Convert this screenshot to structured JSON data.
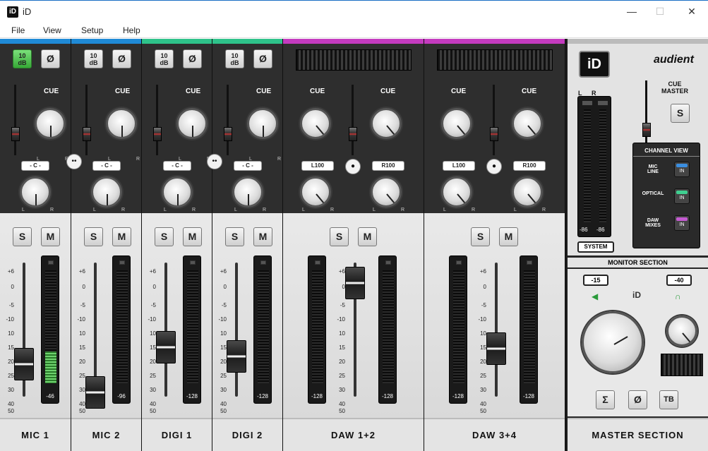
{
  "window": {
    "title": "iD",
    "logo": "iD",
    "minimize": "—",
    "maximize": "☐",
    "close": "✕"
  },
  "menu": {
    "items": [
      "File",
      "View",
      "Setup",
      "Help"
    ]
  },
  "channels": [
    {
      "name": "MIC 1",
      "color": "#1f8ad6",
      "pad": "10\ndB",
      "pad_on": true,
      "phase": "Ø",
      "cue_label": "CUE",
      "pan_label": "- C -",
      "solo": "S",
      "mute": "M",
      "meter": "-46",
      "fader_db": "30",
      "fader_pos": 0.76
    },
    {
      "name": "MIC 2",
      "color": "#1f8ad6",
      "pad": "10\ndB",
      "pad_on": false,
      "phase": "Ø",
      "cue_label": "CUE",
      "pan_label": "- C -",
      "solo": "S",
      "mute": "M",
      "meter": "-96",
      "fader_db": "∞",
      "fader_pos": 0.97
    },
    {
      "name": "DIGI 1",
      "color": "#2ec28a",
      "pad": "10\ndB",
      "pad_on": false,
      "phase": "Ø",
      "cue_label": "CUE",
      "pan_label": "- C -",
      "solo": "S",
      "mute": "M",
      "meter": "-128",
      "fader_db": "20",
      "fader_pos": 0.63
    },
    {
      "name": "DIGI 2",
      "color": "#2ec28a",
      "pad": "10\ndB",
      "pad_on": false,
      "phase": "Ø",
      "cue_label": "CUE",
      "pan_label": "- C -",
      "solo": "S",
      "mute": "M",
      "meter": "-128",
      "fader_db": "25",
      "fader_pos": 0.7
    }
  ],
  "stereo_channels": [
    {
      "name": "DAW 1+2",
      "color": "#c43bbf",
      "cue_label": "CUE",
      "pan_left": "L100",
      "pan_right": "R100",
      "solo": "S",
      "mute": "M",
      "meter_l": "-128",
      "meter_r": "-128",
      "fader_pos": 0.15
    },
    {
      "name": "DAW 3+4",
      "color": "#c43bbf",
      "cue_label": "CUE",
      "pan_left": "L100",
      "pan_right": "R100",
      "solo": "S",
      "mute": "M",
      "meter_l": "-128",
      "meter_r": "-128",
      "fader_pos": 0.64
    }
  ],
  "fader_scale": [
    "6",
    "0",
    "-5",
    "-10",
    "5",
    "10",
    "15",
    "20",
    "30",
    "40",
    "50",
    "∞"
  ],
  "fader_scale_full": [
    "+6",
    "0",
    "-5",
    "-10",
    "10",
    "15",
    "20",
    "25",
    "30",
    "40",
    "50",
    "∞"
  ],
  "master": {
    "logo": "iD",
    "brand": "audient",
    "cue_master": "CUE\nMASTER",
    "cue_solo": "S",
    "channel_view_title": "CHANNEL VIEW",
    "views": [
      {
        "label": "MIC\nLINE",
        "state": "IN",
        "color": "#3a8ee0"
      },
      {
        "label": "OPTICAL",
        "state": "IN",
        "color": "#3fcf90"
      },
      {
        "label": "DAW\nMIXES",
        "state": "IN",
        "color": "#c45ad0"
      }
    ],
    "meter_l": "-86",
    "meter_r": "-86",
    "meter_lbl_l": "L",
    "meter_lbl_r": "R",
    "system_btn": "SYSTEM",
    "monitor_title": "MONITOR SECTION",
    "speaker_level": "-15",
    "phones_level": "-40",
    "monitor_logo": "iD",
    "sum_btn": "Σ",
    "phase_btn": "Ø",
    "talkback_btn": "TB",
    "section_name": "MASTER SECTION"
  }
}
